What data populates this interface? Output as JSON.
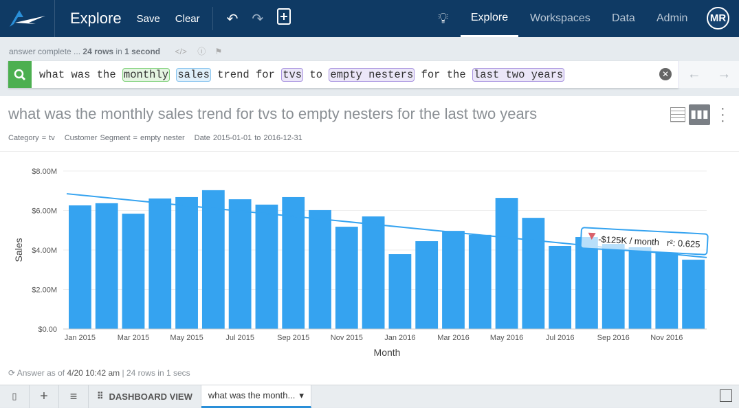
{
  "header": {
    "title": "Explore",
    "save": "Save",
    "clear": "Clear",
    "nav": [
      "Explore",
      "Workspaces",
      "Data",
      "Admin"
    ],
    "avatar": "MR"
  },
  "status": {
    "prefix": "answer complete ... ",
    "rows": "24 rows",
    "mid": " in ",
    "time": "1 second"
  },
  "search": {
    "plain1": "what was the ",
    "t1": "monthly",
    "s1": " ",
    "t2": "sales",
    "plain2": " trend for ",
    "t3": "tvs",
    "plain3": " to ",
    "t4": "empty nesters",
    "plain4": " for the ",
    "t5": "last two years"
  },
  "answer": {
    "title": "what was the monthly sales trend for tvs to empty nesters for the last two years",
    "filters": [
      "Category = tv",
      "Customer Segment = empty nester",
      "Date 2015-01-01 to 2016-12-31"
    ],
    "footer_prefix": "Answer as of ",
    "footer_time": "4/20 10:42 am",
    "footer_rest": " | 24 rows in 1 secs"
  },
  "bottom": {
    "dashboard": "DASHBOARD VIEW",
    "tab": "what was the month..."
  },
  "chart_data": {
    "type": "bar",
    "xlabel": "Month",
    "ylabel": "Sales",
    "ylim": [
      0,
      8
    ],
    "yticks": [
      "$0.00",
      "$2.00M",
      "$4.00M",
      "$6.00M",
      "$8.00M"
    ],
    "categories": [
      "Jan 2015",
      "Feb 2015",
      "Mar 2015",
      "Apr 2015",
      "May 2015",
      "Jun 2015",
      "Jul 2015",
      "Aug 2015",
      "Sep 2015",
      "Oct 2015",
      "Nov 2015",
      "Dec 2015",
      "Jan 2016",
      "Feb 2016",
      "Mar 2016",
      "Apr 2016",
      "May 2016",
      "Jun 2016",
      "Jul 2016",
      "Aug 2016",
      "Sep 2016",
      "Oct 2016",
      "Nov 2016",
      "Dec 2016"
    ],
    "values": [
      6.26,
      6.37,
      5.84,
      6.61,
      6.68,
      7.03,
      6.57,
      6.3,
      6.68,
      6.02,
      5.18,
      5.7,
      3.79,
      4.45,
      4.97,
      4.77,
      6.64,
      5.63,
      4.21,
      4.66,
      4.31,
      4.14,
      3.86,
      3.51
    ],
    "trend": {
      "start": 6.85,
      "end": 3.62,
      "label": "-$125K / month",
      "r2": "r²: 0.625"
    },
    "color": "#35a3f0"
  }
}
